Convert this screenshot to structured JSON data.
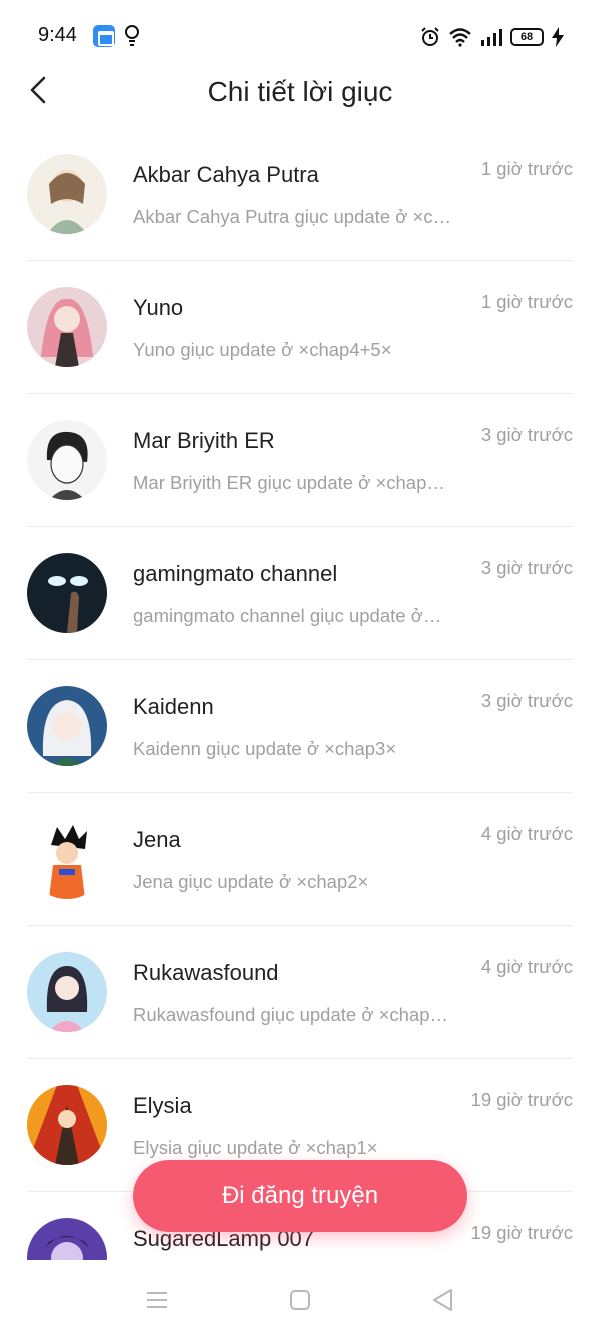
{
  "status_bar": {
    "time": "9:44",
    "battery": "68",
    "icons": [
      "app-store-icon",
      "bulb-icon",
      "alarm-icon",
      "wifi-icon",
      "signal-icon",
      "battery-icon",
      "charging-icon"
    ]
  },
  "header": {
    "title": "Chi tiết lời giục",
    "back_icon": "chevron-left-icon"
  },
  "reminders": [
    {
      "name": "Akbar Cahya Putra",
      "message": "Akbar Cahya Putra giục update ở ×c…",
      "time": "1 giờ trước"
    },
    {
      "name": "Yuno",
      "message": "Yuno giục update ở ×chap4+5×",
      "time": "1 giờ trước"
    },
    {
      "name": "Mar Briyith ER",
      "message": "Mar Briyith ER giục update ở ×chap…",
      "time": "3 giờ trước"
    },
    {
      "name": "gamingmato channel",
      "message": "gamingmato channel giục update ở…",
      "time": "3 giờ trước"
    },
    {
      "name": "Kaidenn",
      "message": "Kaidenn giục update ở ×chap3×",
      "time": "3 giờ trước"
    },
    {
      "name": "Jena",
      "message": "Jena giục update ở ×chap2×",
      "time": "4 giờ trước"
    },
    {
      "name": "Rukawasfound",
      "message": "Rukawasfound giục update ở ×chap…",
      "time": "4 giờ trước"
    },
    {
      "name": "Elysia",
      "message": "Elysia giục update ở ×chap1×",
      "time": "19 giờ trước"
    },
    {
      "name": "SugaredLamp 007",
      "message": "",
      "time": "19 giờ trước"
    }
  ],
  "post_button": {
    "label": "Đi đăng truyện"
  },
  "nav": {
    "menu_icon": "menu-icon",
    "home_icon": "home-square-icon",
    "back_icon": "back-triangle-icon"
  },
  "colors": {
    "accent": "#f65a70",
    "secondary_text": "#a0a0a0",
    "divider": "#ececec"
  }
}
